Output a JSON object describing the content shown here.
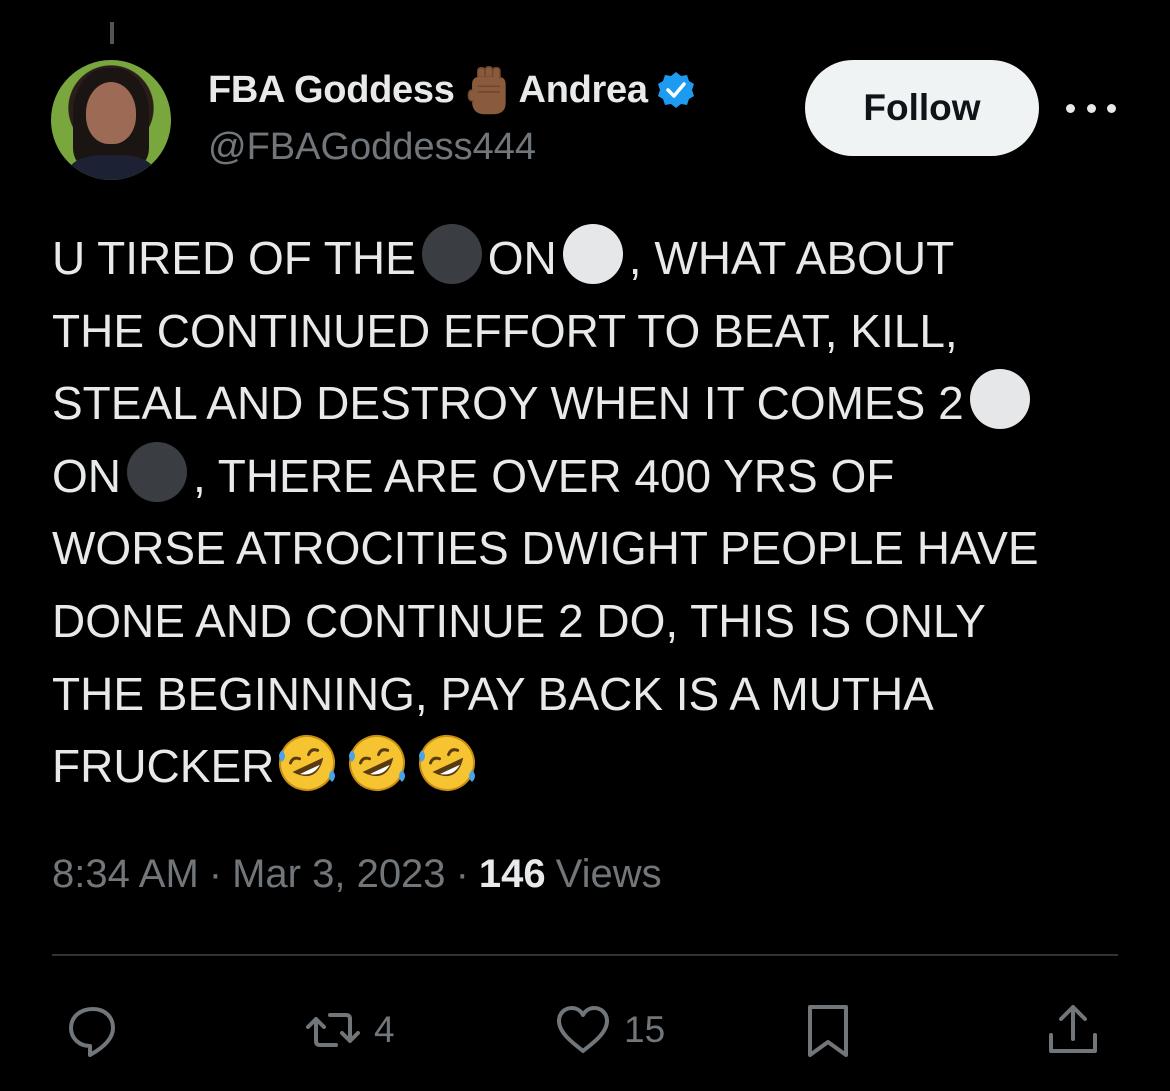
{
  "author": {
    "display_name": "FBA Goddess",
    "display_name_suffix": "Andrea",
    "handle": "@FBAGoddess444",
    "emoji_icon": "raised-fist-medium-dark-skin",
    "verified": true
  },
  "follow_label": "Follow",
  "tweet": {
    "lines": [
      {
        "parts": [
          "U TIRED OF THE",
          "black-circle",
          "ON",
          "white-circle",
          ", WHAT ABOUT"
        ]
      },
      {
        "parts": [
          "THE CONTINUED EFFORT TO BEAT, KILL,"
        ]
      },
      {
        "parts": [
          "STEAL AND DESTROY WHEN IT COMES 2",
          "white-circle"
        ]
      },
      {
        "parts": [
          "ON",
          "black-circle",
          ", THERE ARE OVER 400 YRS OF"
        ]
      },
      {
        "parts": [
          "WORSE ATROCITIES DWIGHT PEOPLE HAVE"
        ]
      },
      {
        "parts": [
          "DONE AND CONTINUE 2 DO, THIS IS ONLY"
        ]
      },
      {
        "parts": [
          "THE BEGINNING, PAY BACK IS A MUTHA"
        ]
      },
      {
        "parts": [
          "FRUCKER",
          "rofl-emoji",
          "rofl-emoji",
          "rofl-emoji"
        ]
      }
    ]
  },
  "meta": {
    "time": "8:34 AM",
    "separator": "·",
    "date": "Mar 3, 2023",
    "views_count": "146",
    "views_label": "Views"
  },
  "actions": {
    "reply_count": "",
    "retweet_count": "4",
    "like_count": "15"
  },
  "colors": {
    "background": "#000000",
    "text": "#e7e9ea",
    "secondary": "#71767b",
    "verified": "#1d9bf0",
    "button_bg": "#eff3f4"
  }
}
